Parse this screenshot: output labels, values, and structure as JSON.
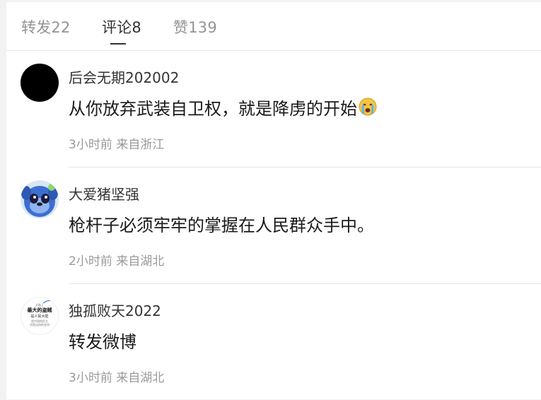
{
  "tabs": [
    {
      "label": "转发22"
    },
    {
      "label": "评论8"
    },
    {
      "label": "赞139"
    }
  ],
  "comments": [
    {
      "username": "后会无期202002",
      "content": "从你放弃武装自卫权，就是降虏的开始",
      "emoji": "crying-face-icon",
      "time": "3小时前",
      "source": "来自浙江"
    },
    {
      "username": "大爱猪坚强",
      "content": "枪杆子必须牢牢的掌握在人民群众手中。",
      "time": "2小时前",
      "source": "来自湖北"
    },
    {
      "username": "独孤败天2022",
      "content": "转发微博",
      "time": "3小时前",
      "source": "来自湖北"
    }
  ],
  "avatar3_text": {
    "line1": "大陆上",
    "line2": "最大的盗贼",
    "line3": "是人民大陆",
    "line4": "是中国的民主",
    "line5": "也是自由的支持"
  },
  "colors": {
    "text_primary": "#333333",
    "text_secondary": "#939393",
    "divider": "#e6e6e6"
  }
}
